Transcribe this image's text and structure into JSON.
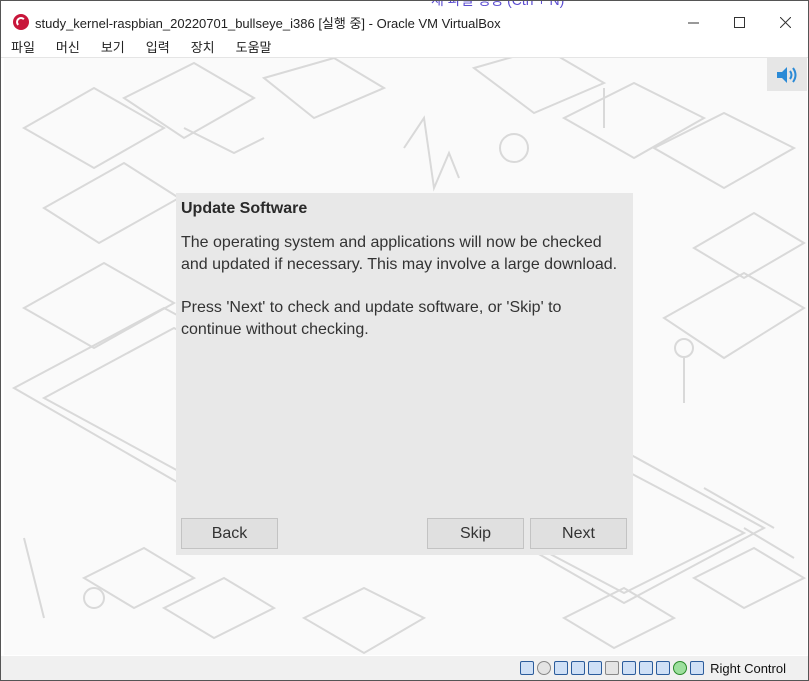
{
  "window": {
    "ghost_title": "새 파일 생성 (Ctrl + N)",
    "title": "study_kernel-raspbian_20220701_bullseye_i386 [실행 중] - Oracle VM VirtualBox",
    "controls": {
      "minimize": "—",
      "maximize": "☐",
      "close": "✕"
    }
  },
  "menu": {
    "items": [
      "파일",
      "머신",
      "보기",
      "입력",
      "장치",
      "도움말"
    ]
  },
  "dialog": {
    "title": "Update Software",
    "paragraph1": "The operating system and applications will now be checked and updated if necessary. This may involve a large download.",
    "paragraph2": "Press 'Next' to check and update software, or 'Skip' to continue without checking.",
    "back_label": "Back",
    "skip_label": "Skip",
    "next_label": "Next"
  },
  "statusbar": {
    "icons": [
      "hard-disk-icon",
      "optical-drive-icon",
      "audio-icon",
      "network-icon",
      "usb-icon",
      "shared-folders-icon",
      "display-icon",
      "video-capture-icon",
      "virtualization-icon",
      "mouse-integration-icon",
      "keyboard-capture-icon"
    ],
    "host_key": "Right Control"
  },
  "colors": {
    "accent": "#c8163a",
    "dialog_bg": "#e8e8e8"
  }
}
